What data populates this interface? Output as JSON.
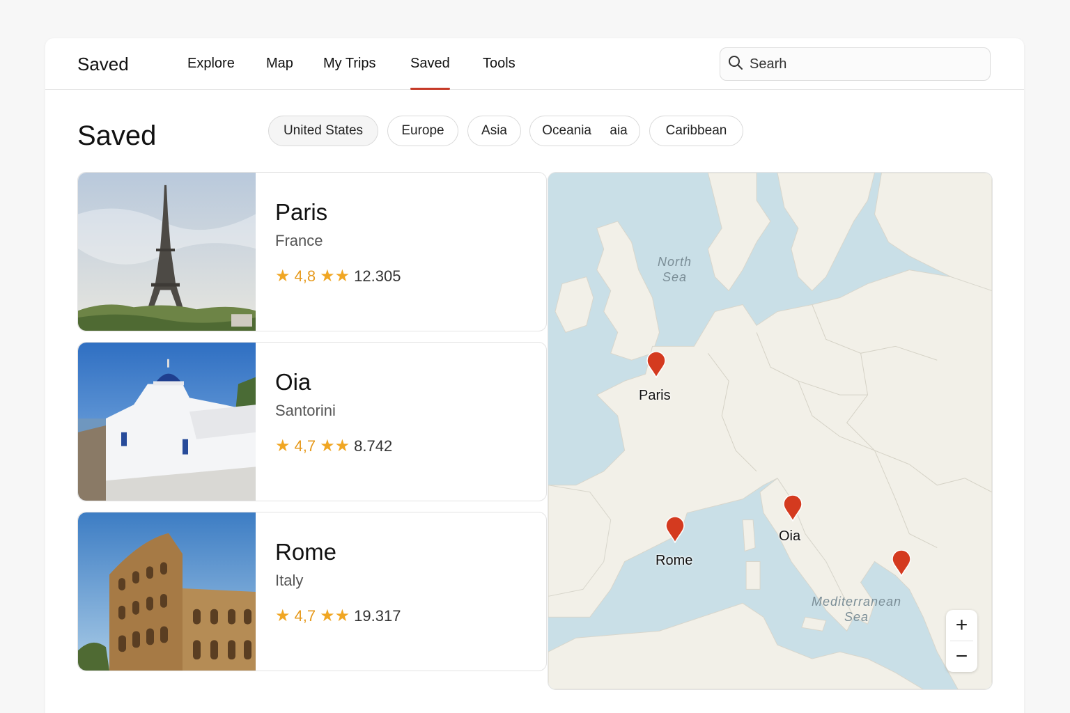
{
  "header": {
    "brand": "Saved",
    "nav": [
      {
        "label": "Explore"
      },
      {
        "label": "Map"
      },
      {
        "label": "My Trips"
      },
      {
        "label": "Saved",
        "active": true
      },
      {
        "label": "Tools"
      }
    ],
    "search": {
      "placeholder": "Searh",
      "icon": "search-icon"
    }
  },
  "page": {
    "title": "Saved",
    "filters": [
      {
        "label": "United States",
        "selected": true
      },
      {
        "label": "Europe"
      },
      {
        "label": "Asia"
      },
      {
        "label": "Oceania     aia"
      },
      {
        "label": "Caribbean"
      }
    ]
  },
  "places": [
    {
      "name": "Paris",
      "subtitle": "France",
      "rating": "4,8",
      "reviews": "12.305",
      "photo": "eiffel-tower"
    },
    {
      "name": "Oia",
      "subtitle": "Santorini",
      "rating": "4,7",
      "reviews": "8.742",
      "photo": "santorini-church"
    },
    {
      "name": "Rome",
      "subtitle": "Italy",
      "rating": "4,7",
      "reviews": "19.317",
      "photo": "colosseum"
    }
  ],
  "map": {
    "water_labels": {
      "north_sea": "North\nSea",
      "mediterranean": "Mediterranean\nSea"
    },
    "pins": [
      {
        "label": "Paris"
      },
      {
        "label": "Oia"
      },
      {
        "label": "Rome"
      },
      {
        "label": ""
      }
    ],
    "zoom": {
      "in": "+",
      "out": "−"
    },
    "colors": {
      "water": "#c9dfe7",
      "land": "#f2f0e8",
      "pin": "#d43a1f"
    }
  },
  "colors": {
    "accent": "#c63a28",
    "star": "#f0a623"
  }
}
